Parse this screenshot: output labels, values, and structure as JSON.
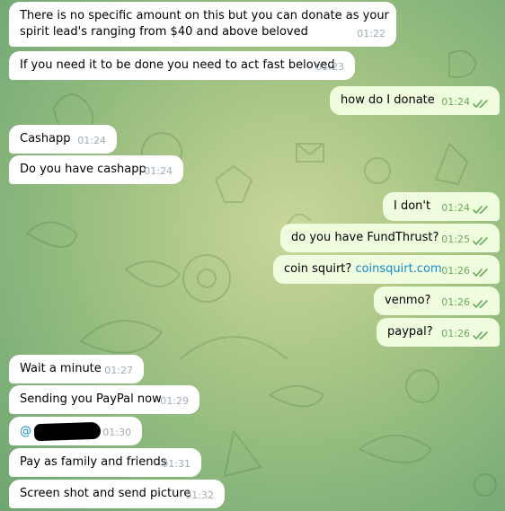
{
  "messages": [
    {
      "dir": "in",
      "text": "There is no specific amount on this but you can donate as your",
      "text2": "spirit lead's ranging from $40 and above beloved",
      "time": "01:22"
    },
    {
      "dir": "in",
      "text": "If you need it to be done you need to act fast beloved",
      "time": "01:23"
    },
    {
      "dir": "out",
      "text": "how do I donate",
      "time": "01:24",
      "status": "read"
    },
    {
      "dir": "in",
      "text": "Cashapp",
      "time": "01:24"
    },
    {
      "dir": "in",
      "text": "Do you have cashapp",
      "time": "01:24"
    },
    {
      "dir": "out",
      "text": "I don't",
      "time": "01:24",
      "status": "read"
    },
    {
      "dir": "out",
      "text": "do you have FundThrust?",
      "time": "01:25",
      "status": "read"
    },
    {
      "dir": "out",
      "text": "coin squirt?",
      "link": "coinsquirt.com",
      "time": "01:26",
      "status": "read"
    },
    {
      "dir": "out",
      "text": "venmo?",
      "time": "01:26",
      "status": "read"
    },
    {
      "dir": "out",
      "text": "paypal?",
      "time": "01:26",
      "status": "read"
    },
    {
      "dir": "in",
      "text": "Wait a minute",
      "time": "01:27"
    },
    {
      "dir": "in",
      "text": "Sending you PayPal now",
      "time": "01:29"
    },
    {
      "dir": "in",
      "text": "@",
      "redacted": true,
      "time": "01:30"
    },
    {
      "dir": "in",
      "text": "Pay as family and friends",
      "time": "01:31"
    },
    {
      "dir": "in",
      "text": "Screen shot and send picture",
      "time": "01:32"
    }
  ],
  "colors": {
    "incoming_bubble": "#ffffff",
    "outgoing_bubble": "#effdde",
    "outgoing_time": "#6aa95d",
    "incoming_time": "#a0acb6",
    "link": "#168acd"
  },
  "icons": {
    "read_receipt": "double-check-icon"
  }
}
